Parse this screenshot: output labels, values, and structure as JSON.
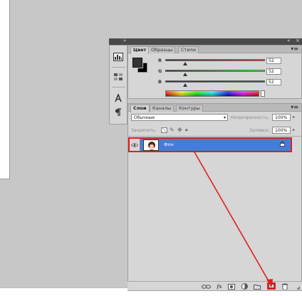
{
  "color_panel": {
    "tabs": [
      "Цвет",
      "Образцы",
      "Стили"
    ],
    "channels": [
      {
        "label": "R",
        "value": "52"
      },
      {
        "label": "G",
        "value": "52"
      },
      {
        "label": "B",
        "value": "52"
      }
    ],
    "colors": {
      "foreground": "#343434",
      "background": "#000000"
    }
  },
  "layers_panel": {
    "tabs": [
      "Слои",
      "Каналы",
      "Контуры"
    ],
    "blend_mode": "Обычные",
    "opacity_label": "Непрозрачность:",
    "opacity_value": "100%",
    "lock_label": "Закрепить:",
    "fill_label": "Заливка:",
    "fill_value": "100%",
    "layer_name": "Фон",
    "selection_color": "#3f7fd9",
    "highlight_color": "#e11e1e"
  },
  "icons": {
    "toolstrip": [
      "histogram-icon",
      "adjustments-icon",
      "character-icon",
      "paragraph-icon"
    ],
    "bottom_bar": [
      "link-layers-icon",
      "layer-style-icon",
      "layer-mask-icon",
      "adjustment-layer-icon",
      "new-group-icon",
      "new-layer-icon",
      "delete-layer-icon"
    ],
    "bottom_bar_fx": "fx"
  }
}
